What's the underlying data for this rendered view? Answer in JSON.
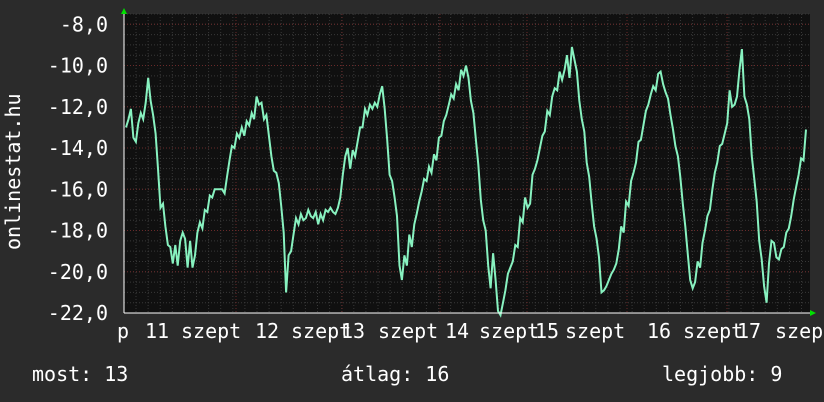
{
  "chart_data": {
    "type": "line",
    "side_label": "onlinestat.hu",
    "y_ticks": [
      "-8,0",
      "-10,0",
      "-12,0",
      "-14,0",
      "-16,0",
      "-18,0",
      "-20,0",
      "-22,0"
    ],
    "ylim": [
      -22,
      -7.5
    ],
    "x_tick_labels": [
      "p",
      "11",
      "szept",
      "12",
      "szept",
      "13",
      "szept",
      "14",
      "szept",
      "15",
      "szept",
      "16",
      "szept",
      "17",
      "szep"
    ],
    "grid": true,
    "colors": {
      "background": "#2b2b2b",
      "plot": "#101010",
      "line": "#88f2c0",
      "grid": "#5a2a2a",
      "axis": "#ffffff",
      "arrow": "#00e000"
    },
    "series": [
      {
        "values": [
          -13,
          -12.6,
          -12.1,
          -13.5,
          -13.7,
          -12.8,
          -12.3,
          -12.6,
          -11.8,
          -10.6,
          -11.7,
          -12.4,
          -13.3,
          -15,
          -16.9,
          -16.7,
          -17.8,
          -18.7,
          -18.8,
          -19.6,
          -18.7,
          -19.7,
          -18.5,
          -18.1,
          -18.4,
          -19.8,
          -18.5,
          -19.8,
          -19.2,
          -18.1,
          -17.6,
          -17.9,
          -17,
          -17.1,
          -16.3,
          -16.4,
          -16,
          -16,
          -16,
          -16,
          -16.2,
          -15.4,
          -14.6,
          -13.9,
          -14,
          -13.3,
          -13.5,
          -13,
          -13.4,
          -12.7,
          -12.9,
          -12.3,
          -12.6,
          -11.5,
          -11.9,
          -11.8,
          -12.6,
          -12.4,
          -13.4,
          -14.4,
          -15.1,
          -15.2,
          -15.7,
          -16.8,
          -18.1,
          -21,
          -19.2,
          -19,
          -18.2,
          -17.4,
          -17.7,
          -17.2,
          -17.5,
          -17.4,
          -17,
          -17.3,
          -17.4,
          -17.1,
          -17.7,
          -17.2,
          -17.5,
          -17,
          -17.1,
          -16.9,
          -17.1,
          -17.2,
          -16.9,
          -16.4,
          -15.3,
          -14.4,
          -14,
          -15,
          -14.1,
          -14.4,
          -13.7,
          -13,
          -13,
          -12.1,
          -12.4,
          -11.9,
          -12.1,
          -11.8,
          -12,
          -11.4,
          -11,
          -12.1,
          -13.6,
          -15.3,
          -15.6,
          -16.4,
          -17.3,
          -19.7,
          -20.4,
          -19.2,
          -19.7,
          -18.2,
          -18.8,
          -17.7,
          -17.2,
          -16.6,
          -16.1,
          -15.5,
          -15.6,
          -14.9,
          -15.2,
          -14.3,
          -14.6,
          -13.5,
          -13.4,
          -12.7,
          -12.4,
          -11.9,
          -11.4,
          -11.6,
          -10.9,
          -11.2,
          -10.2,
          -10.5,
          -10,
          -10.6,
          -11.7,
          -12.3,
          -13.6,
          -14.8,
          -16.5,
          -17.5,
          -18,
          -19.7,
          -20.8,
          -19.1,
          -20.4,
          -21.9,
          -22.1,
          -21.5,
          -20.9,
          -20.1,
          -19.8,
          -19.5,
          -18.7,
          -18.8,
          -17.4,
          -17.6,
          -16.4,
          -16.9,
          -16.7,
          -15.3,
          -15,
          -14.6,
          -14,
          -13.4,
          -13.2,
          -12.2,
          -12.4,
          -11.5,
          -11.1,
          -11.2,
          -10.3,
          -10.7,
          -10.2,
          -9.5,
          -10.6,
          -9.1,
          -9.7,
          -10.3,
          -11.7,
          -12.6,
          -13.2,
          -14.7,
          -15.4,
          -16.7,
          -17.8,
          -18.4,
          -19.3,
          -21,
          -20.9,
          -20.7,
          -20.4,
          -20.1,
          -19.9,
          -19.6,
          -18.9,
          -17.8,
          -18.1,
          -16.6,
          -16.8,
          -15.6,
          -15.2,
          -14.7,
          -13.7,
          -13.6,
          -12.9,
          -12.2,
          -11.9,
          -11.4,
          -11,
          -11.2,
          -10.4,
          -10.3,
          -10.9,
          -11.3,
          -11.6,
          -12.4,
          -13.1,
          -13.9,
          -14.4,
          -15.4,
          -16.7,
          -17.8,
          -19.1,
          -20.4,
          -20.8,
          -20.5,
          -19.5,
          -19.8,
          -18.6,
          -18,
          -17.3,
          -17,
          -16,
          -15.2,
          -14.7,
          -13.9,
          -13.8,
          -13.3,
          -12.8,
          -11.2,
          -12,
          -11.9,
          -11.5,
          -10.2,
          -9.2,
          -11.5,
          -11.9,
          -12.6,
          -14.4,
          -15.5,
          -16.6,
          -18.5,
          -19.4,
          -20.7,
          -21.5,
          -19.6,
          -18.5,
          -18.6,
          -19.3,
          -19.4,
          -18.9,
          -18.8,
          -18.1,
          -17.9,
          -17.3,
          -16.5,
          -15.9,
          -15.3,
          -14.5,
          -14.6,
          -13.1
        ]
      }
    ]
  },
  "stats": {
    "current": "most: 13",
    "average": "átlag: 16",
    "best": "legjobb: 9"
  }
}
